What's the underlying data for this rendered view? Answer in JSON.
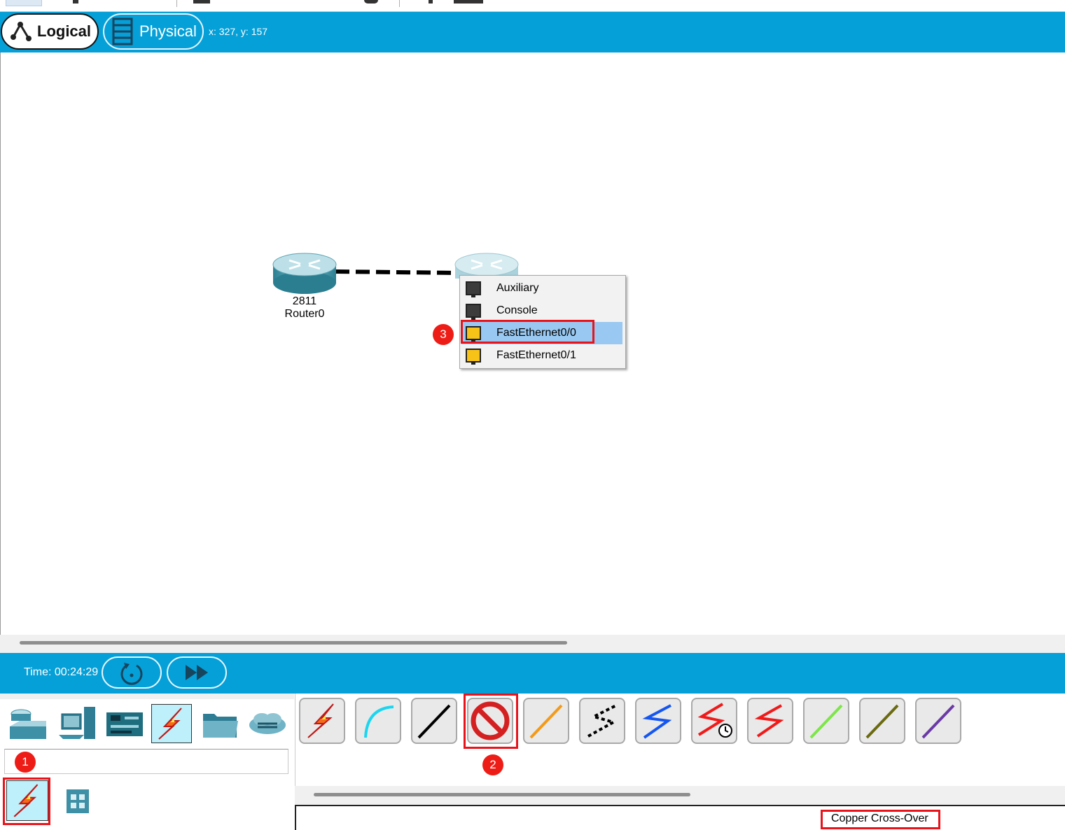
{
  "mode_bar": {
    "logical_label": "Logical",
    "physical_label": "Physical",
    "coordinates": "x: 327, y: 157"
  },
  "devices": [
    {
      "model": "2811",
      "name": "Router0"
    }
  ],
  "port_menu": {
    "items": [
      {
        "label": "Auxiliary",
        "port_color": "#3c3c3c"
      },
      {
        "label": "Console",
        "port_color": "#3c3c3c"
      },
      {
        "label": "FastEthernet0/0",
        "port_color": "#f7c318",
        "highlighted": true
      },
      {
        "label": "FastEthernet0/1",
        "port_color": "#f7c318"
      }
    ]
  },
  "badges": [
    "1",
    "2",
    "3"
  ],
  "sim_bar": {
    "time": "Time: 00:24:29",
    "reset_icon": "power-cycle-icon",
    "fast_forward_icon": "fast-forward-icon"
  },
  "device_categories": [
    "network-devices-icon",
    "end-devices-icon",
    "components-icon",
    "connections-icon",
    "miscellaneous-icon",
    "multiuser-icon"
  ],
  "cables": [
    {
      "name": "automatic-connection-icon",
      "color": "#f03020"
    },
    {
      "name": "console-cable-icon",
      "color": "#1ad6f0"
    },
    {
      "name": "copper-straight-through-icon",
      "color": "#000000"
    },
    {
      "name": "copper-cross-over-icon",
      "color": "#d42020"
    },
    {
      "name": "fiber-icon",
      "color": "#f39a1a"
    },
    {
      "name": "phone-cable-icon",
      "color": "#000000"
    },
    {
      "name": "coaxial-icon",
      "color": "#1556f0"
    },
    {
      "name": "serial-dce-icon",
      "color": "#f01a1a"
    },
    {
      "name": "serial-dte-icon",
      "color": "#f01a1a"
    },
    {
      "name": "octal-icon",
      "color": "#7ee54a"
    },
    {
      "name": "iot-custom-cable-icon",
      "color": "#6a6a10"
    },
    {
      "name": "usb-cable-icon",
      "color": "#6a3aa5"
    }
  ],
  "selected_cable_name": "Copper Cross-Over",
  "colors": {
    "accent_blue": "#05a0d8",
    "annotation_red": "#e8141b",
    "highlight": "#99c9f2"
  }
}
